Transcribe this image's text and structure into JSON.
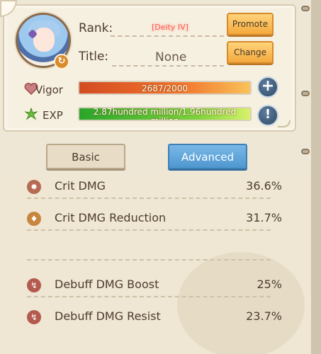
{
  "profile": {
    "rank_label": "Rank:",
    "rank_value": "[Deity IV]",
    "title_label": "Title:",
    "title_value": "None",
    "promote_label": "Promote",
    "change_label": "Change",
    "vigor_label": "Vigor",
    "vigor_value": "2687/2000",
    "vigor_fill": 1.0,
    "exp_label": "EXP",
    "exp_value": "2.87hundred million/1.96hundred million",
    "exp_fill": 1.0,
    "plus_symbol": "+",
    "info_symbol": "!"
  },
  "tabs": {
    "basic": "Basic",
    "advanced": "Advanced"
  },
  "stats": [
    {
      "name": "Crit DMG",
      "value": "36.6%",
      "icon": "crit-icon"
    },
    {
      "name": "Crit DMG Reduction",
      "value": "31.7%",
      "icon": "shield-icon"
    },
    {
      "name": "Debuff DMG Boost",
      "value": "25%",
      "icon": "debuff-icon"
    },
    {
      "name": "Debuff DMG Resist",
      "value": "23.7%",
      "icon": "resist-icon"
    }
  ],
  "colors": {
    "advanced_tab": "#4f97d0",
    "button": "#f4a93d",
    "vigor": "#f2762d",
    "exp": "#7fd33c"
  }
}
